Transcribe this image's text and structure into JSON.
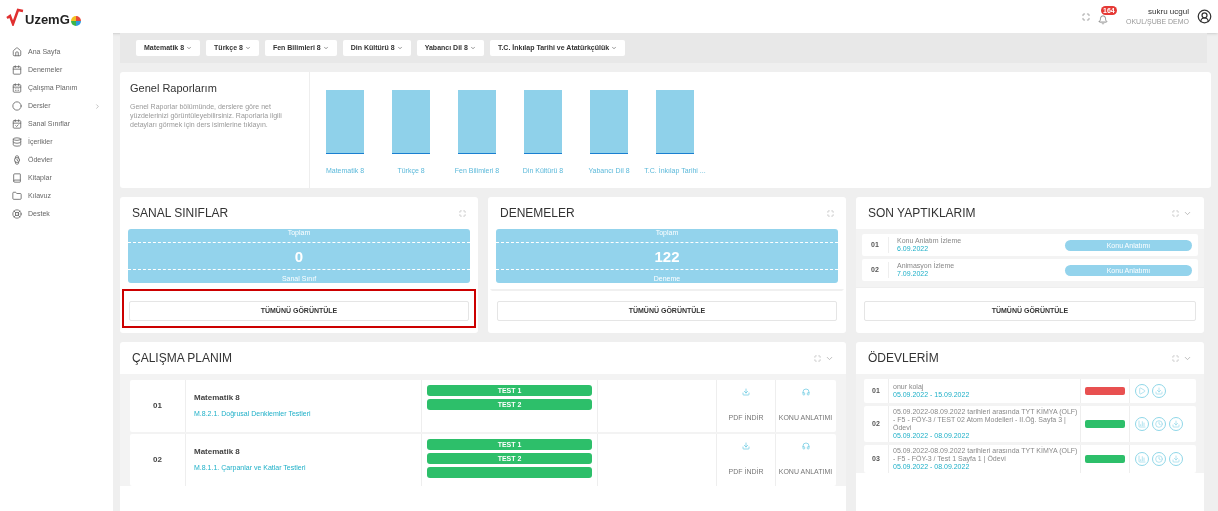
{
  "header": {
    "logo": "UzemG",
    "notification_count": "164",
    "user_name": "sukru ucgul",
    "user_subtitle": "OKUL/ŞUBE DEMO"
  },
  "sidebar": {
    "items": [
      {
        "label": "Ana Sayfa",
        "kind": "home"
      },
      {
        "label": "Denemeler",
        "kind": "exam"
      },
      {
        "label": "Çalışma Planım",
        "kind": "calendar"
      },
      {
        "label": "Dersler",
        "kind": "lessons"
      },
      {
        "label": "Sanal Sınıflar",
        "kind": "classes"
      },
      {
        "label": "İçerikler",
        "kind": "contents"
      },
      {
        "label": "Ödevler",
        "kind": "homework"
      },
      {
        "label": "Kitaplar",
        "kind": "books"
      },
      {
        "label": "Kılavuz",
        "kind": "guide"
      },
      {
        "label": "Destek",
        "kind": "support"
      }
    ]
  },
  "filters": [
    "Matematik 8",
    "Türkçe 8",
    "Fen Bilimleri 8",
    "Din Kültürü 8",
    "Yabancı Dil 8",
    "T.C. İnkılap Tarihi ve Atatürkçülük"
  ],
  "report": {
    "title": "Genel Raporlarım",
    "description": "Genel Raporlar bölümünde, derslere göre net yüzdelerinizi görüntüleyebilirsiniz. Raporlarla ilgili detayları görmek için ders isimlerine tıklayın.",
    "bar_labels": [
      "Matematik 8",
      "Türkçe 8",
      "Fen Bilimleri 8",
      "Din Kültürü 8",
      "Yabancı Dil 8",
      "T.C. İnkılap Tarihi ..."
    ]
  },
  "stat_cards": [
    {
      "title": "SANAL SINIFLAR",
      "top_label": "Toplam",
      "value": "0",
      "bottom_label": "Sanal Sınıf",
      "button": "TÜMÜNÜ GÖRÜNTÜLE",
      "highlighted": true
    },
    {
      "title": "DENEMELER",
      "top_label": "Toplam",
      "value": "122",
      "bottom_label": "Deneme",
      "button": "TÜMÜNÜ GÖRÜNTÜLE",
      "highlighted": false
    }
  ],
  "recent": {
    "title": "SON YAPTIKLARIM",
    "rows": [
      {
        "number": "01",
        "title": "Konu Anlatım İzleme",
        "date": "6.09.2022",
        "action": "Konu Anlatımı"
      },
      {
        "number": "02",
        "title": "Animasyon İzleme",
        "date": "7.09.2022",
        "action": "Konu Anlatımı"
      }
    ],
    "button": "TÜMÜNÜ GÖRÜNTÜLE"
  },
  "plan": {
    "title": "ÇALIŞMA PLANIM",
    "rows": [
      {
        "number": "01",
        "course": "Matematik 8",
        "topic": "M.8.2.1. Doğrusal Denklemler Testleri",
        "tests": [
          "TEST 1",
          "TEST 2"
        ],
        "more_tests": false,
        "pdf": "PDF İNDİR",
        "lecture": "KONU ANLATIMI"
      },
      {
        "number": "02",
        "course": "Matematik 8",
        "topic": "M.8.1.1. Çarpanlar ve Katlar Testleri",
        "tests": [
          "TEST 1",
          "TEST 2"
        ],
        "more_tests": true,
        "pdf": "PDF İNDİR",
        "lecture": "KONU ANLATIMI"
      }
    ]
  },
  "homework": {
    "title": "ÖDEVLERİM",
    "rows": [
      {
        "number": "01",
        "title": "onur kolaj",
        "dates": "05.09.2022 - 15.09.2022",
        "color": "#e85050",
        "kind": "file"
      },
      {
        "number": "02",
        "title": "05.09.2022-08.09.2022 tarihleri arasında TYT KİMYA (OLF) - F5 - FÖY-3 / TEST 02 Atom Modelleri - II.Öğ. Sayfa 3 | Ödevi",
        "dates": "05.09.2022 - 08.09.2022",
        "color": "#2dbf6a",
        "kind": "test"
      },
      {
        "number": "03",
        "title": "05.09.2022-08.09.2022 tarihleri arasında TYT KİMYA (OLF) - F5 - FÖY-3 / Test 1 Sayfa 1 | Ödevi",
        "dates": "05.09.2022 - 08.09.2022",
        "color": "#2dbf6a",
        "kind": "test"
      }
    ]
  }
}
